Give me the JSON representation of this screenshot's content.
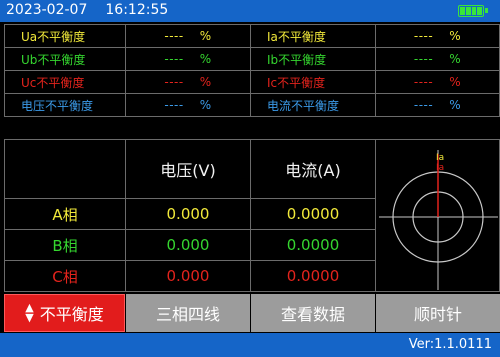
{
  "status_bar": {
    "date": "2023-02-07",
    "time": "16:12:55",
    "battery_level": 1.0
  },
  "unbalance_rows": [
    {
      "left_label": "Ua不平衡度",
      "left_value": "----",
      "left_unit": "%",
      "right_label": "Ia不平衡度",
      "right_value": "----",
      "right_unit": "%",
      "color": "#f2ea3a"
    },
    {
      "left_label": "Ub不平衡度",
      "left_value": "----",
      "left_unit": "%",
      "right_label": "Ib不平衡度",
      "right_value": "----",
      "right_unit": "%",
      "color": "#35d62f"
    },
    {
      "left_label": "Uc不平衡度",
      "left_value": "----",
      "left_unit": "%",
      "right_label": "Ic不平衡度",
      "right_value": "----",
      "right_unit": "%",
      "color": "#e3231c"
    },
    {
      "left_label": "电压不平衡度",
      "left_value": "----",
      "left_unit": "%",
      "right_label": "电流不平衡度",
      "right_value": "----",
      "right_unit": "%",
      "color": "#3b9ae8"
    }
  ],
  "table": {
    "voltage_header": "电压(V)",
    "current_header": "电流(A)",
    "rows": [
      {
        "phase": "A相",
        "voltage": "0.000",
        "current": "0.0000",
        "color": "#f2ea3a"
      },
      {
        "phase": "B相",
        "voltage": "0.000",
        "current": "0.0000",
        "color": "#35d62f"
      },
      {
        "phase": "C相",
        "voltage": "0.000",
        "current": "0.0000",
        "color": "#e3231c"
      }
    ]
  },
  "phasor": {
    "labels": [
      "Ia",
      "Ia"
    ]
  },
  "buttons": {
    "unbalance": "不平衡度",
    "wiring": "三相四线",
    "view_data": "查看数据",
    "direction": "顺时针"
  },
  "version": "Ver:1.1.0111"
}
